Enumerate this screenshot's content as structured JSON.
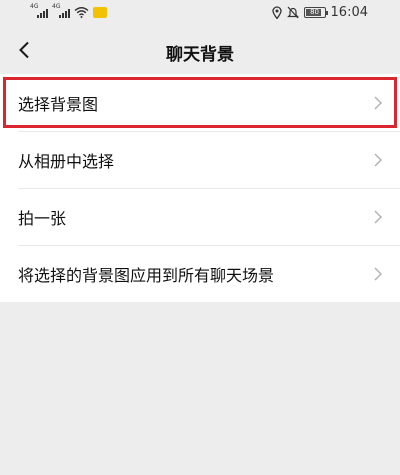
{
  "status_bar": {
    "network_1": "4G",
    "network_2": "4G",
    "battery_level": "80",
    "time": "16:04",
    "icons": [
      "signal-icon",
      "signal-icon",
      "wifi-icon",
      "notification-icon",
      "location-icon",
      "mute-icon",
      "battery-icon"
    ]
  },
  "nav": {
    "back_icon": "chevron-left-icon",
    "title": "聊天背景"
  },
  "menu": {
    "items": [
      {
        "label": "选择背景图",
        "icon": "chevron-right-icon",
        "highlighted": true
      },
      {
        "label": "从相册中选择",
        "icon": "chevron-right-icon"
      },
      {
        "label": "拍一张",
        "icon": "chevron-right-icon"
      },
      {
        "label": "将选择的背景图应用到所有聊天场景",
        "icon": "chevron-right-icon"
      }
    ]
  },
  "colors": {
    "background": "#ededed",
    "list_background": "#ffffff",
    "highlight": "#d9262f",
    "chevron": "#b2b2b2"
  }
}
